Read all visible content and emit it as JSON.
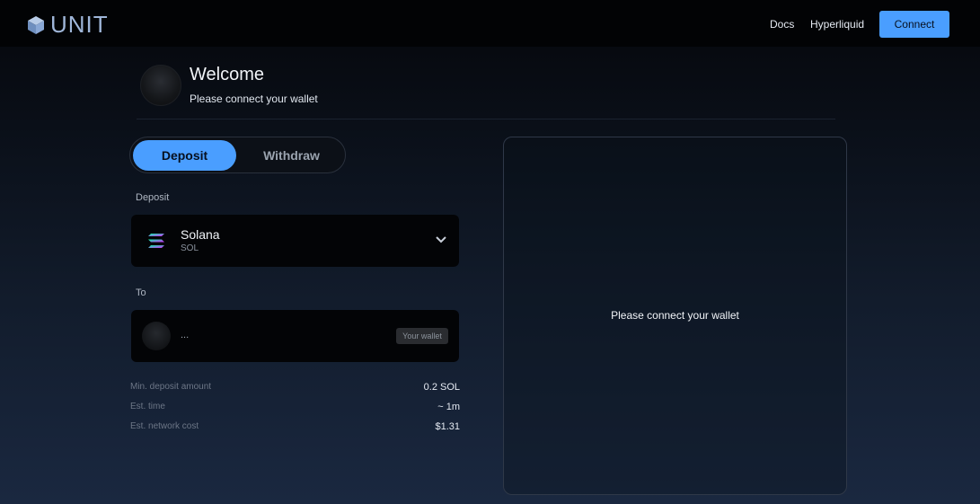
{
  "header": {
    "logo_text": "UNIT",
    "nav": [
      {
        "label": "Docs"
      },
      {
        "label": "Hyperliquid"
      }
    ],
    "connect_label": "Connect"
  },
  "welcome": {
    "title": "Welcome",
    "subtitle": "Please connect your wallet"
  },
  "tabs": {
    "active": "Deposit",
    "items": [
      {
        "label": "Deposit"
      },
      {
        "label": "Withdraw"
      }
    ]
  },
  "deposit": {
    "section_label": "Deposit",
    "asset_name": "Solana",
    "asset_ticker": "SOL"
  },
  "to": {
    "section_label": "To",
    "address": "...",
    "badge": "Your wallet"
  },
  "info": [
    {
      "label": "Min. deposit amount",
      "value": "0.2 SOL"
    },
    {
      "label": "Est. time",
      "value": "~ 1m"
    },
    {
      "label": "Est. network cost",
      "value": "$1.31"
    }
  ],
  "panel": {
    "message": "Please connect your wallet"
  },
  "colors": {
    "accent": "#4a9eff",
    "background_top": "#05070b",
    "background_bottom": "#1a2840"
  }
}
